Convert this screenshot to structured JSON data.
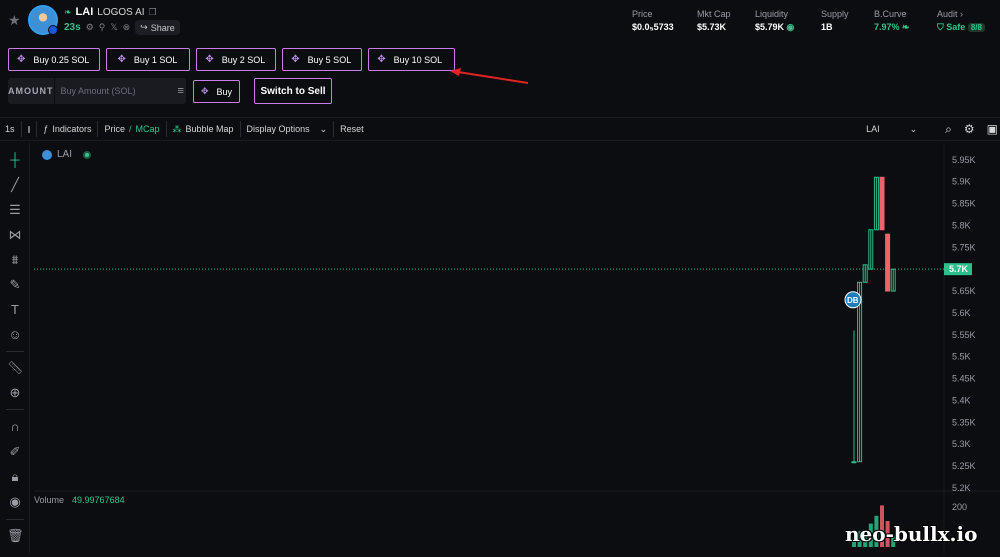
{
  "header": {
    "ticker": "LAI",
    "token_name": "LOGOS AI",
    "age": "23s",
    "share_label": "Share",
    "stats": [
      {
        "label": "Price",
        "value": "$0.0₅5733"
      },
      {
        "label": "Mkt Cap",
        "value": "$5.73K"
      },
      {
        "label": "Liquidity",
        "value": "$5.79K"
      },
      {
        "label": "Supply",
        "value": "1B"
      },
      {
        "label": "B.Curve",
        "value": "7.97%"
      },
      {
        "label": "Audit",
        "value": "Safe"
      }
    ],
    "audit_score": "8/8"
  },
  "quick_buy": {
    "buttons": [
      "Buy 0.25 SOL",
      "Buy 1 SOL",
      "Buy 2 SOL",
      "Buy 5 SOL",
      "Buy 10 SOL"
    ]
  },
  "amount": {
    "label": "AMOUNT",
    "placeholder": "Buy Amount (SOL)",
    "buy_label": "Buy",
    "switch_label": "Switch to Sell"
  },
  "toolbar": {
    "interval": "1s",
    "indicators": "Indicators",
    "price": "Price",
    "slash": "/",
    "mcap": "MCap",
    "bubble_map": "Bubble Map",
    "display_options": "Display Options",
    "reset": "Reset",
    "symbol_select": "LAI"
  },
  "chart": {
    "legend_symbol": "LAI",
    "y_ticks": [
      "5.95K",
      "5.9K",
      "5.85K",
      "5.8K",
      "5.75K",
      "5.7K",
      "5.65K",
      "5.6K",
      "5.55K",
      "5.5K",
      "5.45K",
      "5.4K",
      "5.35K",
      "5.3K",
      "5.25K",
      "5.2K"
    ],
    "current_price_label": "5.7K",
    "marker_label": "DB",
    "volume_label": "Volume",
    "volume_value": "49.99767684",
    "volume_tick": "200",
    "colors": {
      "up": "#2bbf8a",
      "down": "#f0616d",
      "accent": "#31c48d"
    }
  },
  "chart_data": {
    "type": "candlestick",
    "ylim": [
      5.2,
      5.97
    ],
    "candles": [
      {
        "o": 5.26,
        "h": 5.56,
        "l": 5.26,
        "c": 5.26
      },
      {
        "o": 5.26,
        "h": 5.67,
        "l": 5.26,
        "c": 5.67
      },
      {
        "o": 5.67,
        "h": 5.71,
        "l": 5.67,
        "c": 5.71
      },
      {
        "o": 5.7,
        "h": 5.79,
        "l": 5.7,
        "c": 5.79
      },
      {
        "o": 5.79,
        "h": 5.91,
        "l": 5.79,
        "c": 5.91
      },
      {
        "o": 5.91,
        "h": 5.91,
        "l": 5.79,
        "c": 5.79
      },
      {
        "o": 5.78,
        "h": 5.78,
        "l": 5.65,
        "c": 5.65
      },
      {
        "o": 5.65,
        "h": 5.7,
        "l": 5.65,
        "c": 5.7
      }
    ],
    "volumes": [
      20,
      60,
      40,
      90,
      120,
      160,
      100,
      40
    ],
    "current_price": 5.7
  },
  "watermark": "neo-bullx.io"
}
